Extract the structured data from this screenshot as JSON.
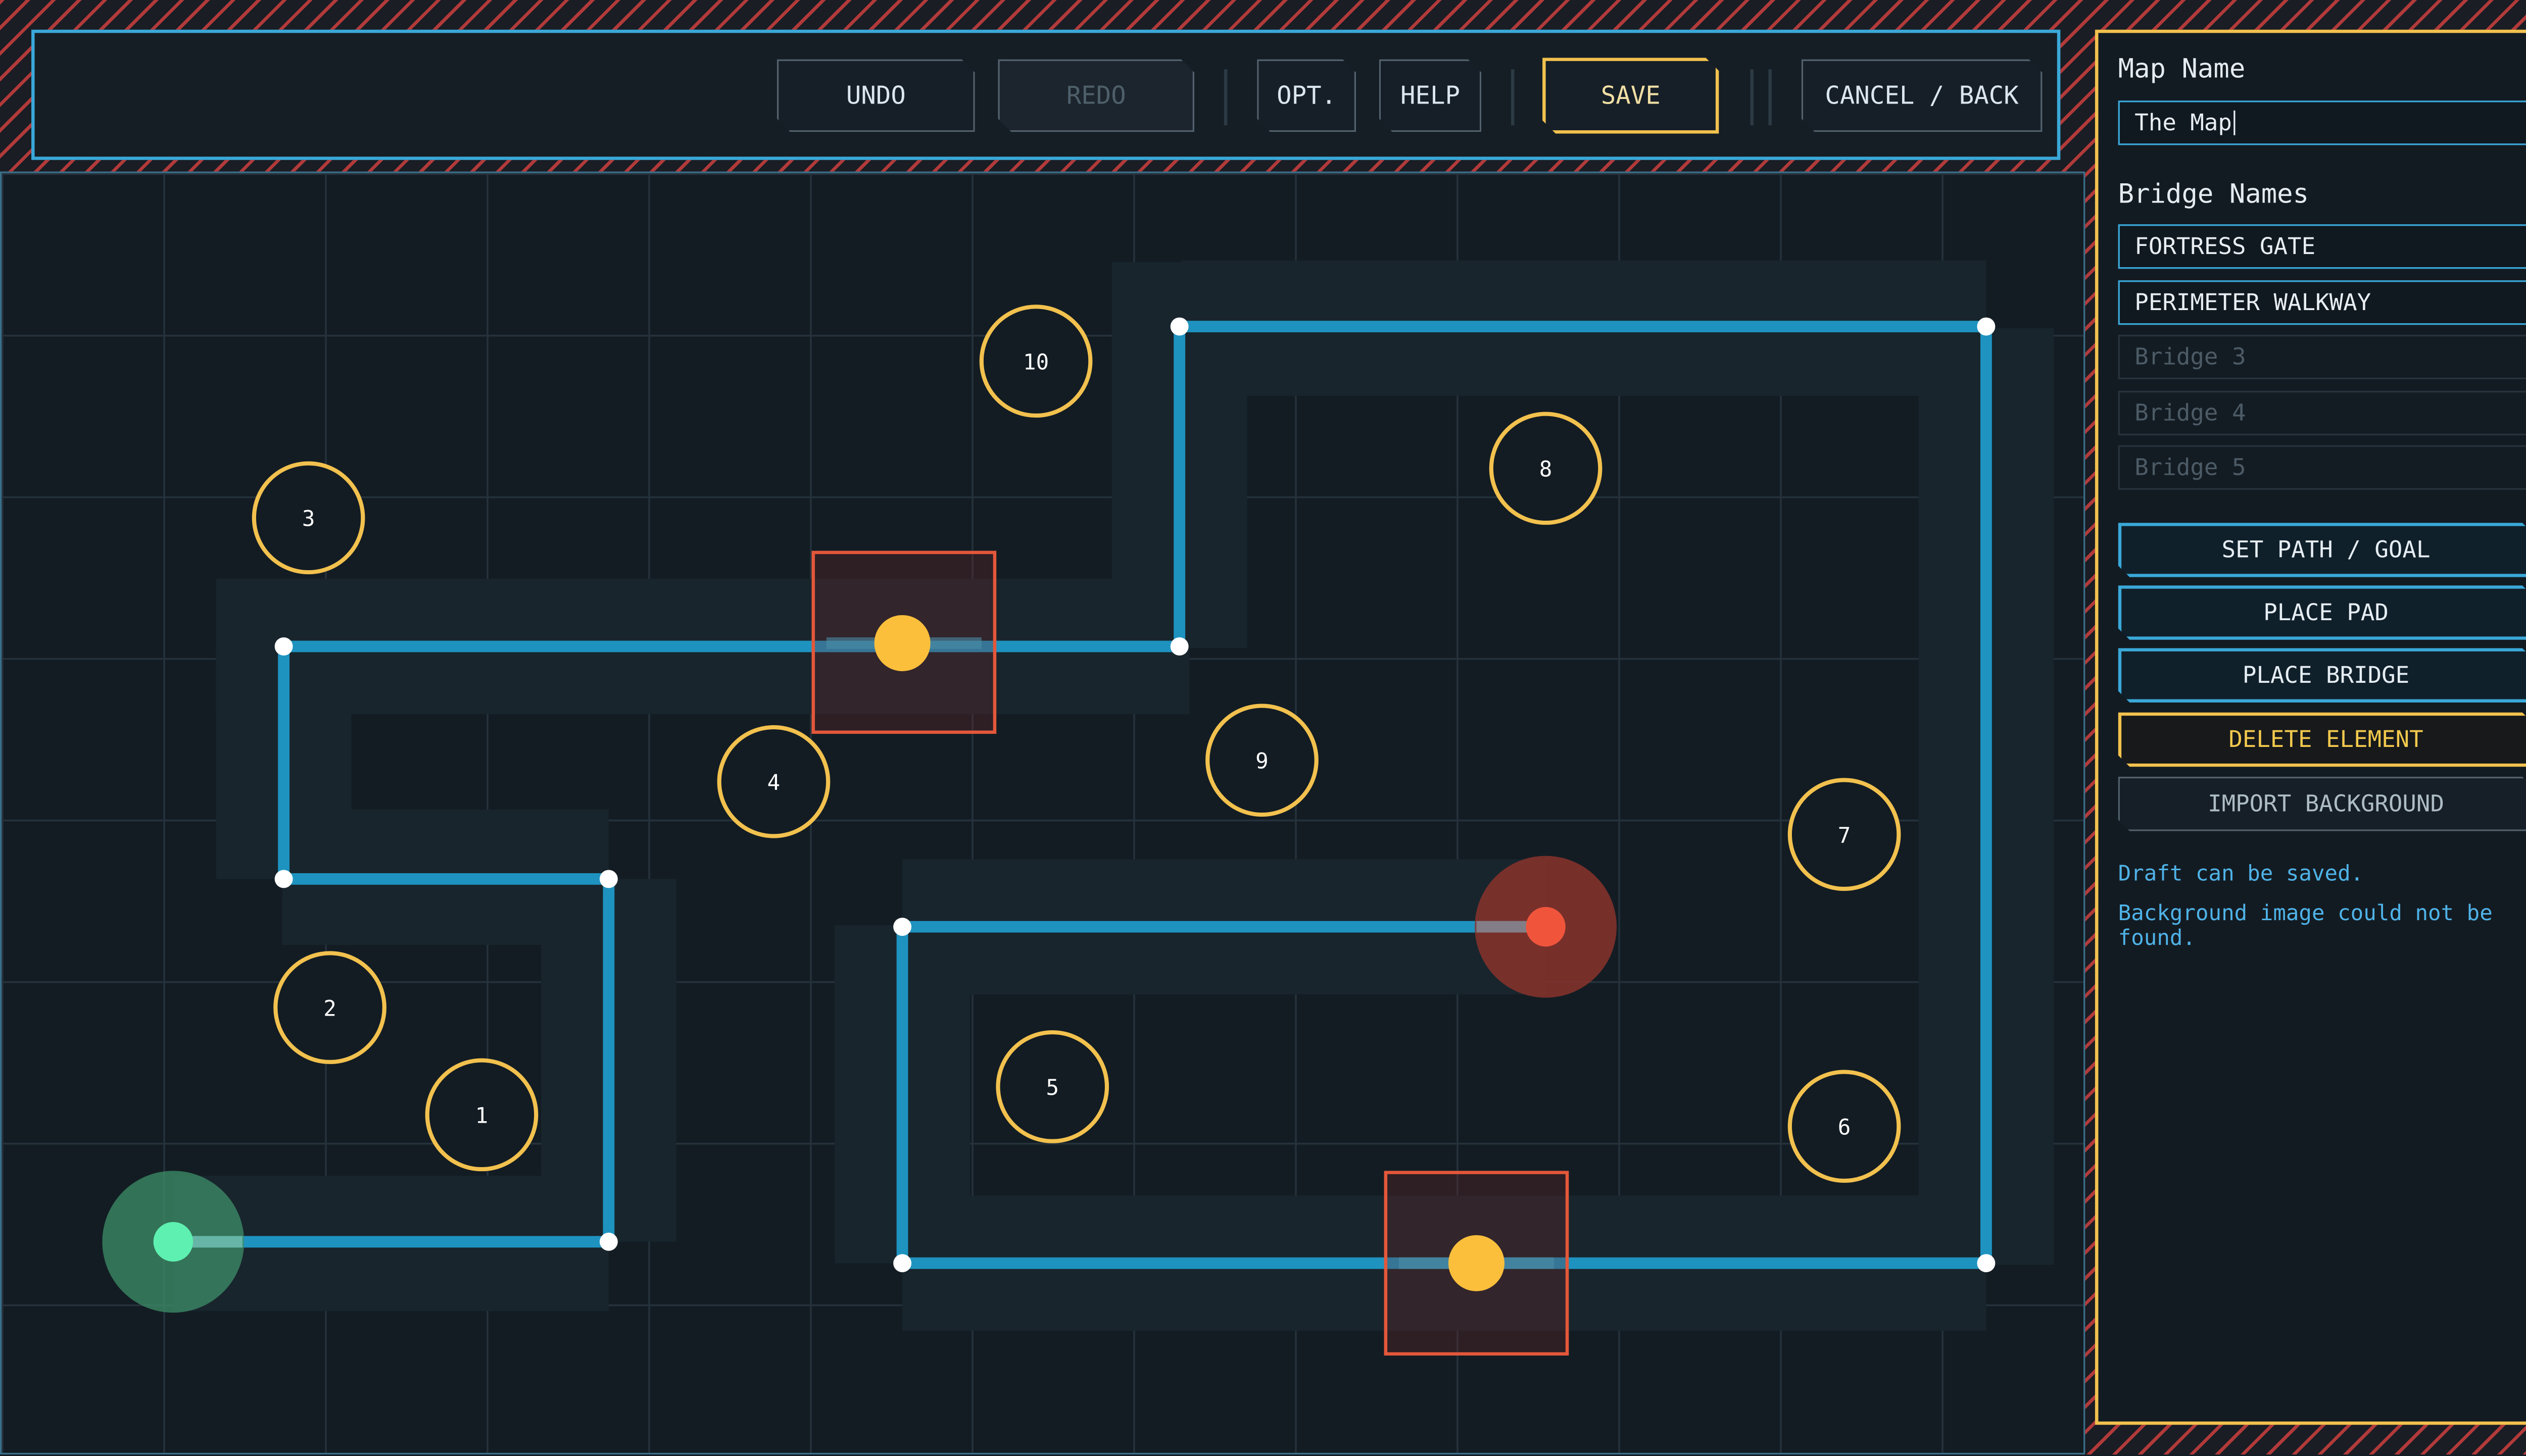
{
  "toolbar": {
    "undo": "UNDO",
    "redo": "REDO",
    "options": "OPT.",
    "help": "HELP",
    "save": "SAVE",
    "cancel": "CANCEL / BACK"
  },
  "panel": {
    "map_name_label": "Map Name",
    "map_name_value": "The Map",
    "bridge_names_label": "Bridge Names",
    "bridge_names": [
      {
        "value": "FORTRESS GATE",
        "placeholder": ""
      },
      {
        "value": "PERIMETER WALKWAY",
        "placeholder": ""
      },
      {
        "value": "",
        "placeholder": "Bridge 3"
      },
      {
        "value": "",
        "placeholder": "Bridge 4"
      },
      {
        "value": "",
        "placeholder": "Bridge 5"
      }
    ],
    "buttons": {
      "set_path": "SET PATH / GOAL",
      "place_pad": "PLACE PAD",
      "place_bridge": "PLACE BRIDGE",
      "delete_element": "DELETE ELEMENT",
      "import_background": "IMPORT BACKGROUND"
    },
    "status": [
      "Draft can be saved.",
      "Background image could not be found."
    ]
  },
  "map": {
    "pads": [
      "1",
      "2",
      "3",
      "4",
      "5",
      "6",
      "7",
      "8",
      "9",
      "10"
    ]
  },
  "colors": {
    "accent": "#3aa8d8",
    "highlight": "#f2c14e",
    "path": "#1e93c0",
    "start": "#5ef0b0",
    "goal": "#f0553c",
    "bridge_border": "#e4573a"
  },
  "icons": {
    "start": "start-marker-icon",
    "goal": "goal-marker-icon",
    "bridge": "bridge-marker-icon"
  }
}
